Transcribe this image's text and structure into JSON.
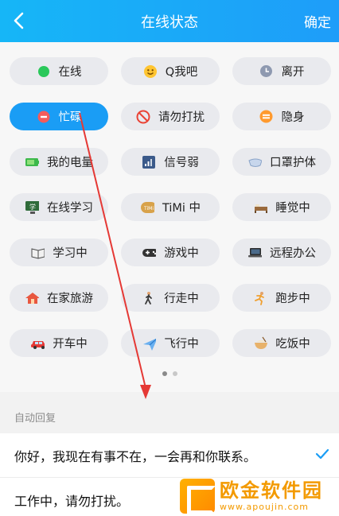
{
  "header": {
    "title": "在线状态",
    "confirm_label": "确定",
    "back_icon": "chevron-left-icon"
  },
  "statuses": [
    {
      "label": "在线",
      "icon": "green-dot-icon",
      "active": false
    },
    {
      "label": "Q我吧",
      "icon": "smiley-icon",
      "active": false
    },
    {
      "label": "离开",
      "icon": "clock-icon",
      "active": false
    },
    {
      "label": "忙碌",
      "icon": "no-entry-icon",
      "active": true
    },
    {
      "label": "请勿打扰",
      "icon": "prohibited-icon",
      "active": false
    },
    {
      "label": "隐身",
      "icon": "invisible-icon",
      "active": false
    },
    {
      "label": "我的电量",
      "icon": "battery-icon",
      "active": false
    },
    {
      "label": "信号弱",
      "icon": "signal-icon",
      "active": false
    },
    {
      "label": "口罩护体",
      "icon": "mask-icon",
      "active": false
    },
    {
      "label": "在线学习",
      "icon": "computer-learning-icon",
      "active": false
    },
    {
      "label": "TiMi 中",
      "icon": "timi-icon",
      "active": false
    },
    {
      "label": "睡觉中",
      "icon": "bed-icon",
      "active": false
    },
    {
      "label": "学习中",
      "icon": "book-icon",
      "active": false
    },
    {
      "label": "游戏中",
      "icon": "gamepad-icon",
      "active": false
    },
    {
      "label": "远程办公",
      "icon": "laptop-icon",
      "active": false
    },
    {
      "label": "在家旅游",
      "icon": "house-icon",
      "active": false
    },
    {
      "label": "行走中",
      "icon": "walking-icon",
      "active": false
    },
    {
      "label": "跑步中",
      "icon": "running-icon",
      "active": false
    },
    {
      "label": "开车中",
      "icon": "car-icon",
      "active": false
    },
    {
      "label": "飞行中",
      "icon": "airplane-icon",
      "active": false
    },
    {
      "label": "吃饭中",
      "icon": "bowl-icon",
      "active": false
    }
  ],
  "pager": {
    "pages": 2,
    "current": 1
  },
  "auto_reply": {
    "title": "自动回复",
    "items": [
      {
        "text": "你好，我现在有事不在，一会再和你联系。",
        "selected": true
      },
      {
        "text": "工作中，请勿打扰。",
        "selected": false
      }
    ]
  },
  "watermark": {
    "main": "欧金软件园",
    "sub": "www.apoujin.com"
  },
  "colors": {
    "header": "#1e9df9",
    "active_pill": "#1a9df5",
    "arrow": "#e53935"
  }
}
